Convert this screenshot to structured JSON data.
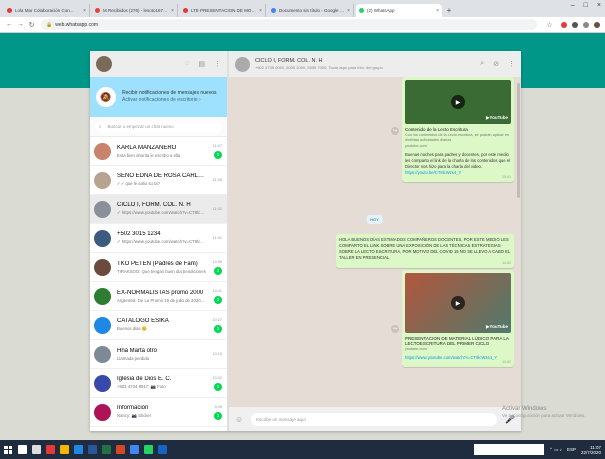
{
  "browser": {
    "tabs": [
      {
        "label": "Lola Mar Colaboración Con...",
        "fav": "#e53935"
      },
      {
        "label": "M Recibidos (276) - lesoto1677@g...",
        "fav": "#ea4335"
      },
      {
        "label": "LTE PRESENTACION DE MODE...",
        "fav": "#e53935"
      },
      {
        "label": "Documento sin título - Google Docs",
        "fav": "#4285f4"
      },
      {
        "label": "(2) WhatsApp",
        "fav": "#25d366",
        "active": true
      }
    ],
    "new_tab": "+",
    "url": "web.whatsapp.com",
    "window_controls": [
      "–",
      "□",
      "×"
    ]
  },
  "sidebar": {
    "notification": {
      "title": "Recibir notificaciones de mensajes nuevos",
      "subtitle": "Activar notificaciones de escritorio ›"
    },
    "search_placeholder": "Buscar o empezar un chat nuevo",
    "chats": [
      {
        "name": "KARLA MANZANERO",
        "msg": "Esta bien ahorita le escribo a ella",
        "time": "11:07",
        "badge": "1",
        "color": "#c9826b"
      },
      {
        "name": "SEÑO EDNA DE ROSA CARLOTA",
        "msg": "✓✓ que le salio su ta?",
        "time": "11:05",
        "badge": "",
        "color": "#b9a28e"
      },
      {
        "name": "CICLO I, FORM. COL. N. H",
        "msg": "✓ https://www.youtube.com/watch?v=CT8lcWzs...",
        "time": "11:02",
        "badge": "",
        "color": "#8a9099",
        "selected": true
      },
      {
        "name": "+502 3015 1234",
        "msg": "✓ https://www.youtube.com/watch?v=CT8lcWz...",
        "time": "11:01",
        "badge": "",
        "color": "#3d5a80"
      },
      {
        "name": "TKO PETEN (Padres de Fam)",
        "msg": "TIRAKSOO: Que tengan buen dia bendiciones",
        "time": "10:56",
        "badge": "1",
        "color": "#6b4b3e"
      },
      {
        "name": "EX-NORMALISTAS promo 2000",
        "msg": "Argentina: De La Promo 15 de julio de 2020...",
        "time": "10:41",
        "badge": "1",
        "color": "#2e7d32"
      },
      {
        "name": "CATALOGO ESIKA",
        "msg": "Buenos dias 😊",
        "time": "10:27",
        "badge": "1",
        "color": "#1e88e5"
      },
      {
        "name": "Hna Marta otro",
        "msg": "Llamada perdida",
        "time": "10:15",
        "badge": "",
        "color": "#7d8a96"
      },
      {
        "name": "Iglesia de Dios E. C.",
        "msg": "+502 4734 8917: 📷 Foto",
        "time": "10:02",
        "badge": "1",
        "color": "#3949ab"
      },
      {
        "name": "Información",
        "msg": "Nancy: 📷 Sticker",
        "time": "9:49",
        "badge": "1",
        "color": "#ad1457"
      }
    ]
  },
  "conversation": {
    "title": "CICLO I, FORM. COL. N. H",
    "subtitle": "+502 4735 0000, 5030 2000, 5555 7000, Tocar aquí para info. del grupo",
    "card1": {
      "title": "Contenido de la Lecto Escritura",
      "desc": "Con los contenidos de la Lecto escritura, se podrán aplicar en distintas actividades diarias",
      "domain": "youtube.com",
      "text": "Buenas noches para padres y docentes, por este medio les comparto el link de la charla de los contenidos que el Director nos hizo para la charla del video.",
      "link": "https://youtu.be/CT8lcWzs4_Y",
      "time": "10:41"
    },
    "day_label": "HOY",
    "notice": {
      "text": "HOLA BUENOS DÍAS ESTIMADOS COMPAÑEROS DOCENTES, POR ESTE MEDIO LES COMPARTO EL LINK SOBRE UNA EXPOSICIÓN DE LAS TÉCNICAS ESTRATEGIAS SOBRE LA LECTO ESCRITURA, POR MOTIVO DEL COVID 19 NO SE LLEVO A CABO EL TALLER EN PRESENCIAL.",
      "time": "11:02"
    },
    "card2": {
      "title": "PRESENTACION DE MATERIAL LÚDICO PARA LA LECTOESCRITURA DEL PRIMER CICLO",
      "domain": "youtube.com",
      "link": "https://www.youtube.com/watch?v=CT8lcWzs4_Y",
      "time": "11:02"
    },
    "composer_placeholder": "Escribe un mensaje aquí"
  },
  "watermark": {
    "title": "Activar Windows",
    "subtitle": "Ve a Configuración para activar Windows."
  },
  "taskbar": {
    "lang": "ESP",
    "time": "11:07",
    "date": "22/7/2020"
  }
}
